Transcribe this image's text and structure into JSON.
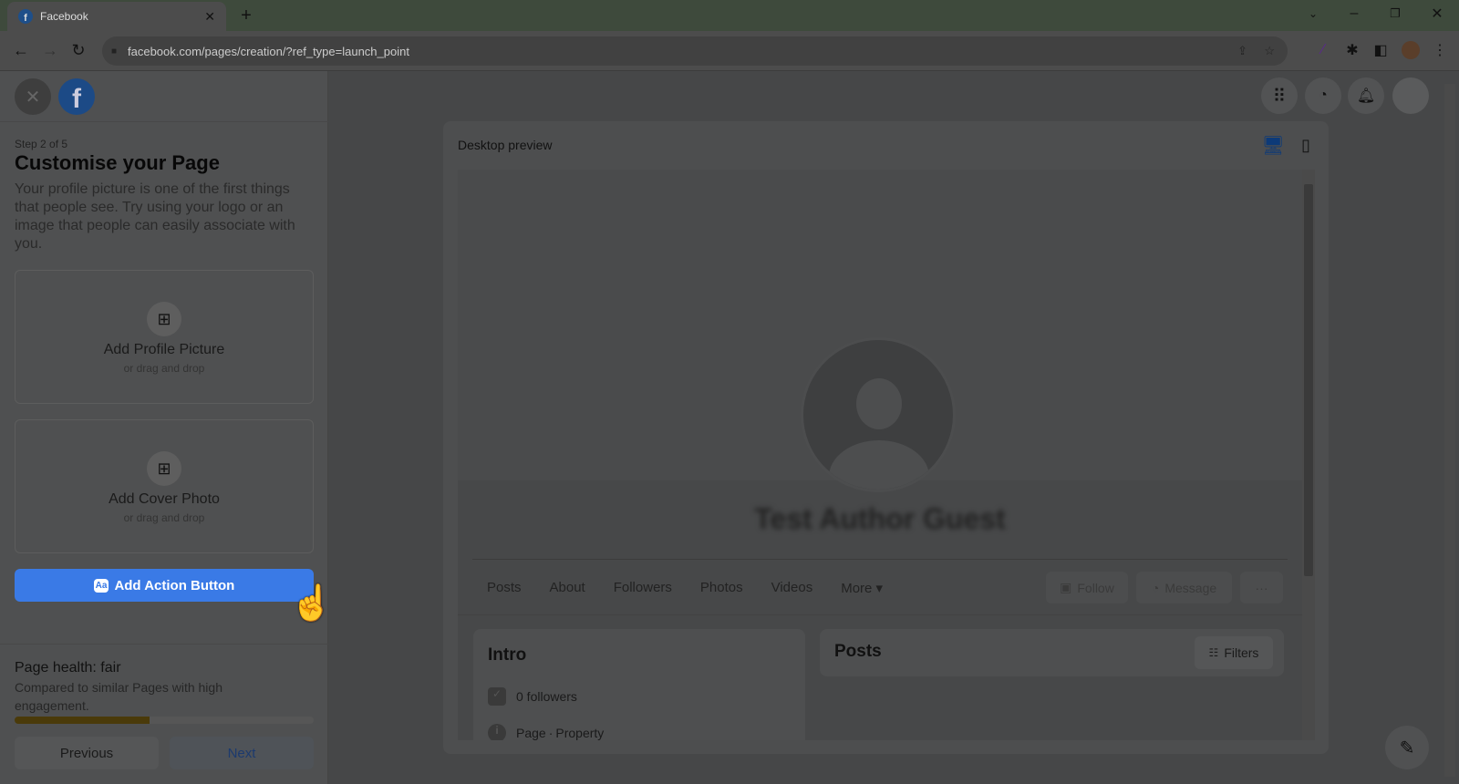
{
  "browser": {
    "tab_title": "Facebook",
    "url": "facebook.com/pages/creation/?ref_type=launch_point"
  },
  "sidebar": {
    "step": "Step 2 of 5",
    "title": "Customise your Page",
    "description": "Your profile picture is one of the first things that people see. Try using your logo or an image that people can easily associate with you.",
    "profile_card": {
      "title": "Add Profile Picture",
      "subtitle": "or drag and drop"
    },
    "cover_card": {
      "title": "Add Cover Photo",
      "subtitle": "or drag and drop"
    },
    "action_button": "Add Action Button",
    "action_icon": "Aa",
    "health": {
      "title": "Page health: fair",
      "description": "Compared to similar Pages with high engagement.",
      "progress_percent": 45,
      "color": "#4a3a0a"
    },
    "previous": "Previous",
    "next": "Next"
  },
  "preview": {
    "title": "Desktop preview",
    "page_name": "Test Author Guest",
    "tabs": [
      "Posts",
      "About",
      "Followers",
      "Photos",
      "Videos",
      "More"
    ],
    "follow": "Follow",
    "message": "Message",
    "more_dots": "···",
    "intro_title": "Intro",
    "followers": "0 followers",
    "page_type": "Page",
    "category": "Property",
    "posts_title": "Posts",
    "filters": "Filters"
  },
  "colors": {
    "accent": "#3a7ae6"
  }
}
